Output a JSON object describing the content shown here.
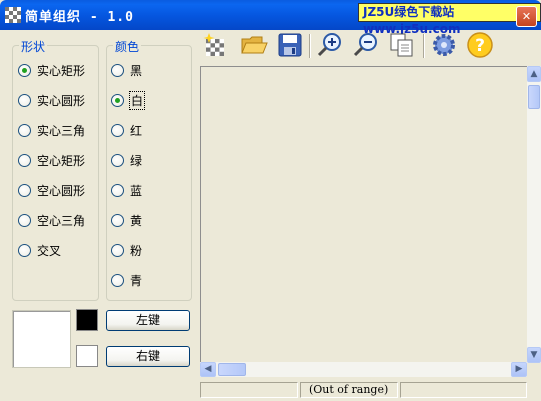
{
  "window": {
    "title": "简单组织 - 1.0",
    "watermark": "JZ5U绿色下载站www.jz5u.com",
    "close_glyph": "✕"
  },
  "shape_group": {
    "title": "形状",
    "options": [
      {
        "label": "实心矩形",
        "checked": true
      },
      {
        "label": "实心圆形",
        "checked": false
      },
      {
        "label": "实心三角",
        "checked": false
      },
      {
        "label": "空心矩形",
        "checked": false
      },
      {
        "label": "空心圆形",
        "checked": false
      },
      {
        "label": "空心三角",
        "checked": false
      },
      {
        "label": "交叉",
        "checked": false
      }
    ]
  },
  "color_group": {
    "title": "颜色",
    "options": [
      {
        "label": "黑",
        "checked": false
      },
      {
        "label": "白",
        "checked": true
      },
      {
        "label": "红",
        "checked": false
      },
      {
        "label": "绿",
        "checked": false
      },
      {
        "label": "蓝",
        "checked": false
      },
      {
        "label": "黄",
        "checked": false
      },
      {
        "label": "粉",
        "checked": false
      },
      {
        "label": "青",
        "checked": false
      }
    ]
  },
  "preview": {
    "left_color": "#000000",
    "right_color": "#ffffff",
    "left_button": "左键",
    "right_button": "右键"
  },
  "toolbar": {
    "icons": [
      "new-icon",
      "open-folder-icon",
      "save-icon",
      "zoom-in-icon",
      "zoom-out-icon",
      "copy-pages-icon",
      "settings-gear-icon",
      "help-icon"
    ]
  },
  "status": {
    "left": "",
    "middle": "(Out of range)",
    "right": ""
  },
  "colors": {
    "titlebar": "#0555de",
    "face": "#ece9d8",
    "group_title": "#0046d5"
  }
}
